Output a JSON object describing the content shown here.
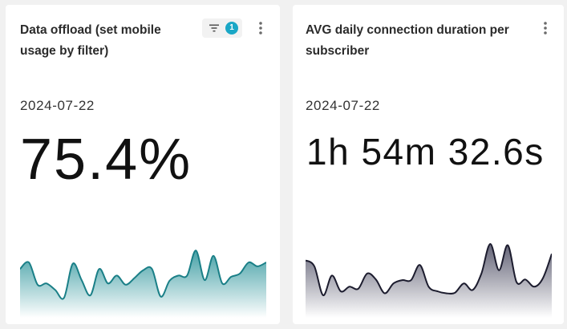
{
  "cards": [
    {
      "title": "Data offload (set mobile usage by filter)",
      "filter_count": "1",
      "date": "2024-07-22",
      "value": "75.4%",
      "icons": {
        "filter": "filter-icon",
        "menu": "more-vertical-icon"
      },
      "colors": {
        "line": "#1a7f87",
        "fill_top": "#3e9da3",
        "fill_bottom": "#ffffff"
      },
      "sparkline": [
        0.62,
        0.72,
        0.38,
        0.4,
        0.3,
        0.18,
        0.7,
        0.45,
        0.22,
        0.62,
        0.4,
        0.52,
        0.38,
        0.48,
        0.6,
        0.62,
        0.2,
        0.44,
        0.52,
        0.52,
        0.9,
        0.45,
        0.82,
        0.4,
        0.5,
        0.55,
        0.72,
        0.66,
        0.72
      ]
    },
    {
      "title": "AVG daily connection duration per subscriber",
      "date": "2024-07-22",
      "value": "1h 54m 32.6s",
      "icons": {
        "menu": "more-vertical-icon"
      },
      "colors": {
        "line": "#1c1c2e",
        "fill_top": "#5c5c70",
        "fill_bottom": "#ffffff"
      },
      "sparkline": [
        0.75,
        0.66,
        0.22,
        0.52,
        0.28,
        0.35,
        0.32,
        0.55,
        0.46,
        0.25,
        0.4,
        0.45,
        0.45,
        0.68,
        0.35,
        0.28,
        0.25,
        0.26,
        0.4,
        0.3,
        0.55,
        1.0,
        0.6,
        0.98,
        0.42,
        0.46,
        0.35,
        0.48,
        0.85
      ]
    }
  ]
}
